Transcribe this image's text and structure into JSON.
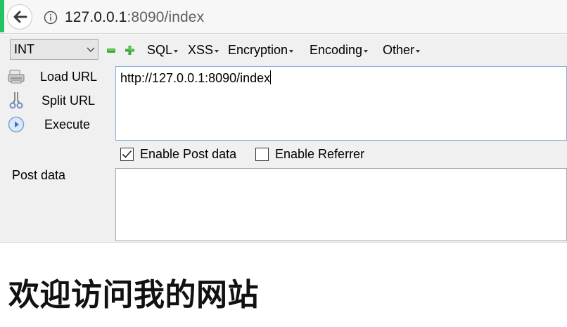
{
  "browser": {
    "url_host": "127.0.0.1",
    "url_rest": ":8090/index"
  },
  "hackbar": {
    "encode_select_value": "INT",
    "menus": [
      {
        "label": "SQL"
      },
      {
        "label": "XSS"
      },
      {
        "label": "Encryption"
      },
      {
        "label": "Encoding"
      },
      {
        "label": "Other"
      }
    ],
    "actions": {
      "load_url": "Load URL",
      "split_url": "Split URL",
      "execute": "Execute"
    },
    "url_field_value": "http://127.0.0.1:8090/index",
    "enable_post_label": "Enable Post data",
    "enable_post_checked": true,
    "enable_referrer_label": "Enable Referrer",
    "enable_referrer_checked": false,
    "post_data_label": "Post data",
    "post_data_value": ""
  },
  "page": {
    "heading": "欢迎访问我的网站"
  },
  "colors": {
    "accent_green": "#25c167",
    "minus_green": "#3fa83a",
    "plus_green": "#3fa83a",
    "url_box_border": "#7fb1dc"
  }
}
